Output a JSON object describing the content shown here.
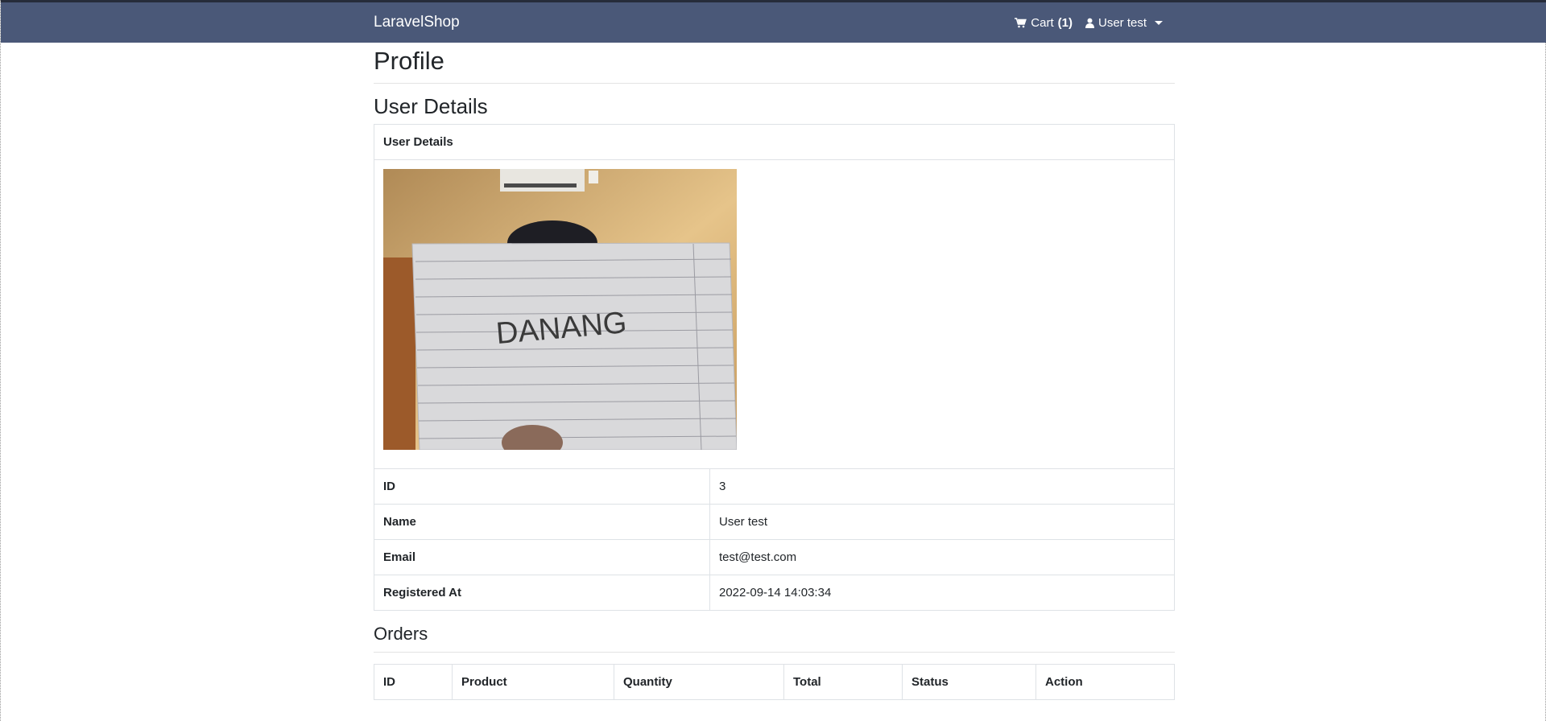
{
  "navbar": {
    "brand": "LaravelShop",
    "cart_label": "Cart",
    "cart_count": "(1)",
    "user_label": "User test"
  },
  "page": {
    "title": "Profile",
    "section_title": "User Details"
  },
  "details": {
    "header": "User Details",
    "photo_text": "DANANG",
    "rows": [
      {
        "key": "ID",
        "value": "3"
      },
      {
        "key": "Name",
        "value": "User test"
      },
      {
        "key": "Email",
        "value": "test@test.com"
      },
      {
        "key": "Registered At",
        "value": "2022-09-14 14:03:34"
      }
    ]
  },
  "orders": {
    "title": "Orders",
    "columns": [
      "ID",
      "Product",
      "Quantity",
      "Total",
      "Status",
      "Action"
    ]
  },
  "colors": {
    "navbar": "#4a5878",
    "text": "#212529",
    "border": "#dee2e6"
  },
  "icons": {
    "cart": "shopping-cart-icon",
    "user": "user-icon",
    "dropdown": "caret-down-icon"
  }
}
